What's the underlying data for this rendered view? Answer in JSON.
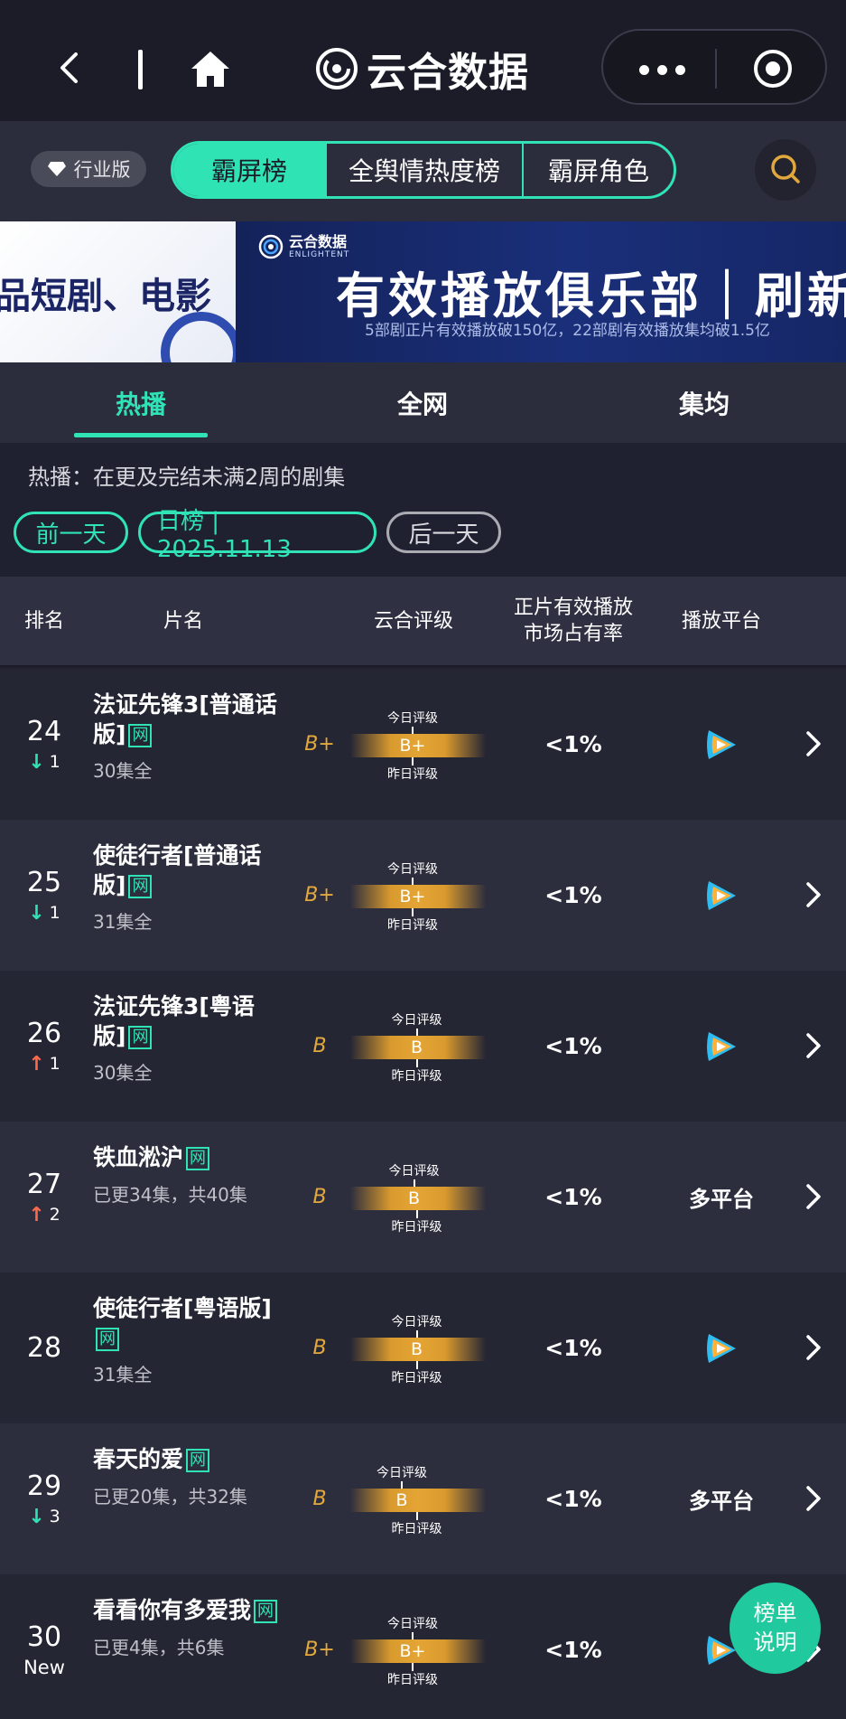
{
  "app": {
    "title": "云合数据"
  },
  "edition_badge": "行业版",
  "main_tabs": [
    {
      "label": "霸屏榜",
      "active": true
    },
    {
      "label": "全舆情热度榜",
      "active": false
    },
    {
      "label": "霸屏角色",
      "active": false
    }
  ],
  "banner": {
    "left_text": "品短剧、电影",
    "logo_cn": "云合数据",
    "logo_en": "ENLIGHTENT",
    "title": "有效播放俱乐部｜刷新",
    "subtitle": "5部剧正片有效播放破150亿，22部剧有效播放集均破1.5亿"
  },
  "sub_tabs": [
    {
      "label": "热播",
      "active": true
    },
    {
      "label": "全网",
      "active": false
    },
    {
      "label": "集均",
      "active": false
    }
  ],
  "description": "热播：在更及完结未满2周的剧集",
  "date_nav": {
    "prev": "前一天",
    "current": "日榜 | 2025.11.13",
    "next": "后一天"
  },
  "table_headers": {
    "rank": "排名",
    "title": "片名",
    "rating": "云合评级",
    "share": "正片有效播放\n市场占有率",
    "platform": "播放平台"
  },
  "rating_labels": {
    "today": "今日评级",
    "yesterday": "昨日评级"
  },
  "colors": {
    "accent": "#2fe3b5",
    "up": "#ff6a4d",
    "down": "#2fe3b5",
    "grade": "#e3a83c",
    "background": "#1f2030"
  },
  "rows": [
    {
      "rank": "24",
      "change": {
        "dir": "down",
        "arrow": "↓",
        "value": "1"
      },
      "title": "法证先锋3[普通话版]",
      "tag": "网",
      "sub": "30集全",
      "grade": "B+",
      "bar_letter": "B+",
      "today_pos": 0.46,
      "yesterday_pos": 0.46,
      "share": "<1%",
      "platform": {
        "type": "icon",
        "icon": "tencent-video-icon",
        "text": ""
      }
    },
    {
      "rank": "25",
      "change": {
        "dir": "down",
        "arrow": "↓",
        "value": "1"
      },
      "title": "使徒行者[普通话版]",
      "tag": "网",
      "sub": "31集全",
      "grade": "B+",
      "bar_letter": "B+",
      "today_pos": 0.46,
      "yesterday_pos": 0.46,
      "share": "<1%",
      "platform": {
        "type": "icon",
        "icon": "tencent-video-icon",
        "text": ""
      }
    },
    {
      "rank": "26",
      "change": {
        "dir": "up",
        "arrow": "↑",
        "value": "1"
      },
      "title": "法证先锋3[粤语版]",
      "tag": "网",
      "sub": "30集全",
      "grade": "B",
      "bar_letter": "B",
      "today_pos": 0.49,
      "yesterday_pos": 0.49,
      "share": "<1%",
      "platform": {
        "type": "icon",
        "icon": "tencent-video-icon",
        "text": ""
      }
    },
    {
      "rank": "27",
      "change": {
        "dir": "up",
        "arrow": "↑",
        "value": "2"
      },
      "title": "铁血淞沪",
      "tag": "网",
      "sub": "已更34集，共40集",
      "grade": "B",
      "bar_letter": "B",
      "today_pos": 0.47,
      "yesterday_pos": 0.49,
      "share": "<1%",
      "platform": {
        "type": "text",
        "icon": "",
        "text": "多平台"
      }
    },
    {
      "rank": "28",
      "change": {
        "dir": "",
        "arrow": "",
        "value": ""
      },
      "title": "使徒行者[粤语版]",
      "tag": "网",
      "sub": "31集全",
      "grade": "B",
      "bar_letter": "B",
      "today_pos": 0.49,
      "yesterday_pos": 0.49,
      "share": "<1%",
      "platform": {
        "type": "icon",
        "icon": "tencent-video-icon",
        "text": ""
      }
    },
    {
      "rank": "29",
      "change": {
        "dir": "down",
        "arrow": "↓",
        "value": "3"
      },
      "title": "春天的爱",
      "tag": "网",
      "sub": "已更20集，共32集",
      "grade": "B",
      "bar_letter": "B",
      "today_pos": 0.38,
      "yesterday_pos": 0.49,
      "share": "<1%",
      "platform": {
        "type": "text",
        "icon": "",
        "text": "多平台"
      }
    },
    {
      "rank": "30",
      "change": {
        "dir": "new",
        "arrow": "",
        "value": "New"
      },
      "title": "看看你有多爱我",
      "tag": "网",
      "sub": "已更4集，共6集",
      "grade": "B+",
      "bar_letter": "B+",
      "today_pos": 0.46,
      "yesterday_pos": 0.46,
      "share": "<1%",
      "platform": {
        "type": "icon",
        "icon": "tencent-video-icon",
        "text": ""
      }
    }
  ],
  "fab": {
    "line1": "榜单",
    "line2": "说明"
  }
}
